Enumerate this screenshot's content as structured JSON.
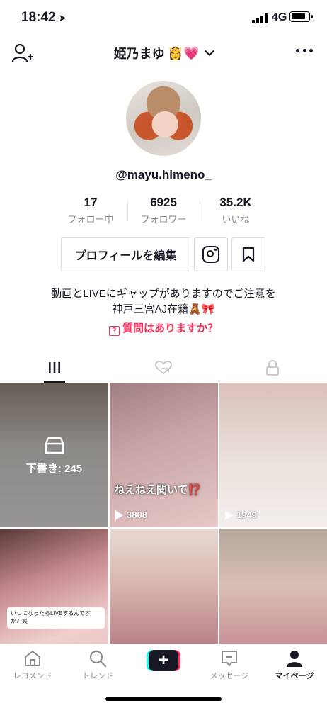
{
  "status_bar": {
    "time": "18:42",
    "network": "4G"
  },
  "header": {
    "username_title": "姫乃まゆ",
    "title_emojis": "👸💗"
  },
  "profile": {
    "handle": "@mayu.himeno_",
    "stats": [
      {
        "value": "17",
        "label": "フォロー中"
      },
      {
        "value": "6925",
        "label": "フォロワー"
      },
      {
        "value": "35.2K",
        "label": "いいね"
      }
    ],
    "edit_button": "プロフィールを編集",
    "bio_line1": "動画とLIVEにギャップがありますのでご注意を",
    "bio_line2": "神戸三宮AJ在籍🧸🎀",
    "question_prompt": "質問はありますか？"
  },
  "grid": {
    "draft_label": "下書き: 245",
    "cells": [
      {
        "views": ""
      },
      {
        "views": "3808",
        "caption": "ねえねえ聞いて⁉️"
      },
      {
        "views": "1949"
      },
      {
        "views": "",
        "sticker": "いつになったらLIVEするんですか？笑"
      },
      {
        "views": ""
      },
      {
        "views": ""
      }
    ]
  },
  "bottom_nav": {
    "items": [
      {
        "label": "レコメンド"
      },
      {
        "label": "トレンド"
      },
      {
        "label": ""
      },
      {
        "label": "メッセージ"
      },
      {
        "label": "マイページ"
      }
    ]
  },
  "colors": {
    "accent": "#fe2c55",
    "text": "#161823",
    "muted": "#8a8b91"
  }
}
